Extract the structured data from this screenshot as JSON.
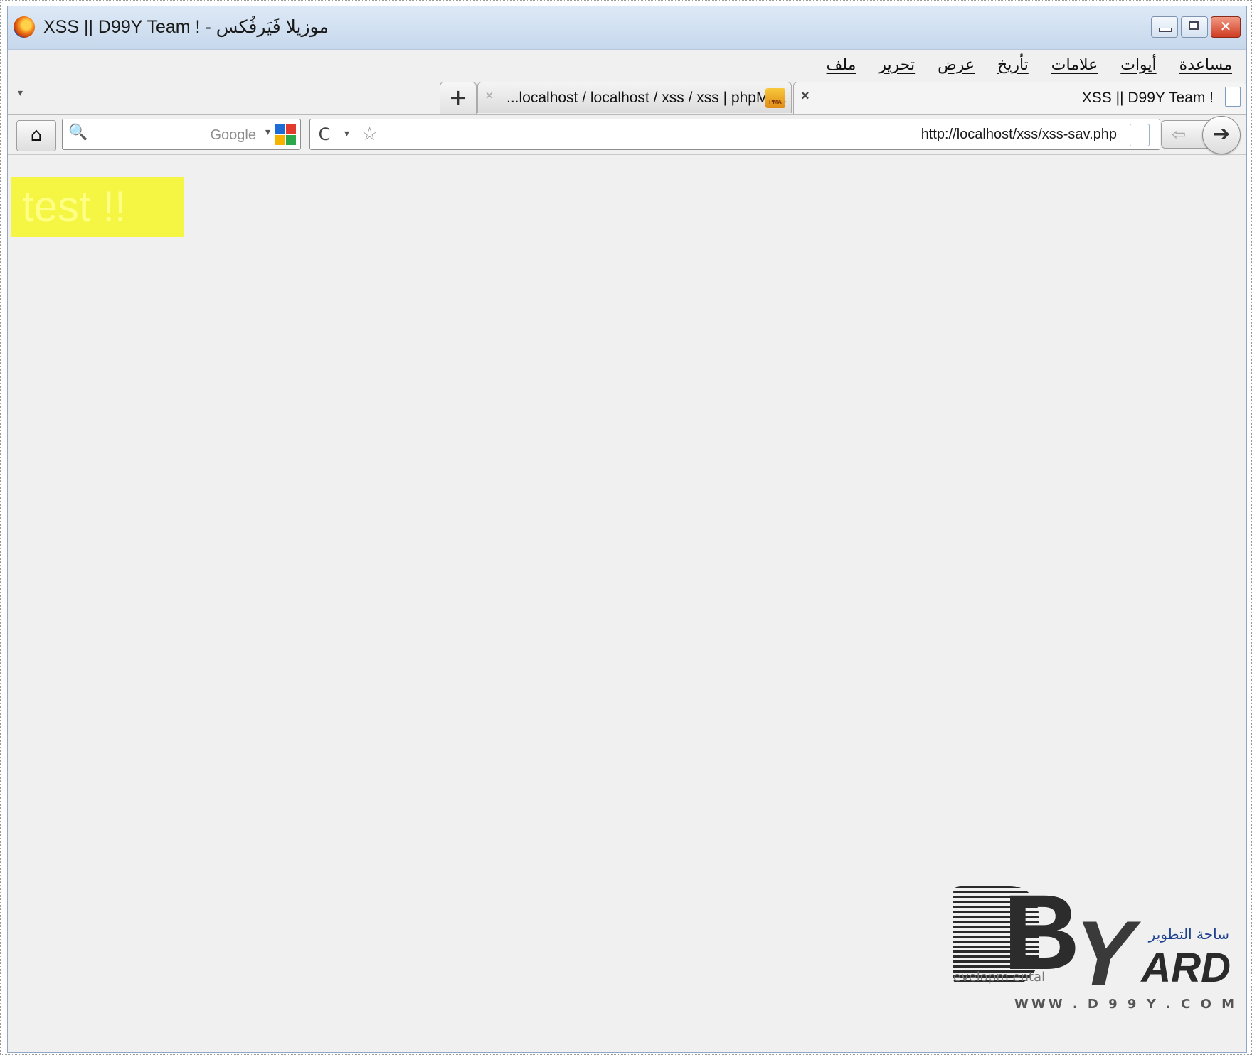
{
  "window": {
    "title": "XSS || D99Y Team ! - موزيلا فَيَرفُكس"
  },
  "menu": [
    "ملف",
    "تحرير",
    "عرض",
    "تأريخ",
    "علامات",
    "أيوات",
    "مساعدة"
  ],
  "tabs": {
    "list_all_symbol": "▾",
    "new_tab_symbol": "+",
    "items": [
      {
        "label": "XSS || D99Y Team !",
        "close": "×",
        "active": true
      },
      {
        "label": "...localhost / localhost / xss / xss | phpMyA",
        "close": "×",
        "active": false,
        "icon_text": "PMA"
      }
    ]
  },
  "nav": {
    "home_symbol": "⌂",
    "search": {
      "placeholder": "Google",
      "value": "",
      "magnifier": "🔍",
      "dropdown": "▾"
    },
    "url": "http://localhost/xss/xss-sav.php",
    "reload_symbol": "C",
    "history_dropdown": "▾",
    "bookmark_star": "☆",
    "back_symbol": "⇦",
    "forward_symbol": "➔"
  },
  "content": {
    "highlight_text": "test !!",
    "highlight_color": "#f5f543"
  },
  "watermark": {
    "big_b": "B",
    "big_y": "Y",
    "ard": "ARD",
    "arabic": "ساحة التطوير",
    "dev_text": "evelopm ental",
    "www_text": "WWW . D 9 9 Y . C O M"
  }
}
